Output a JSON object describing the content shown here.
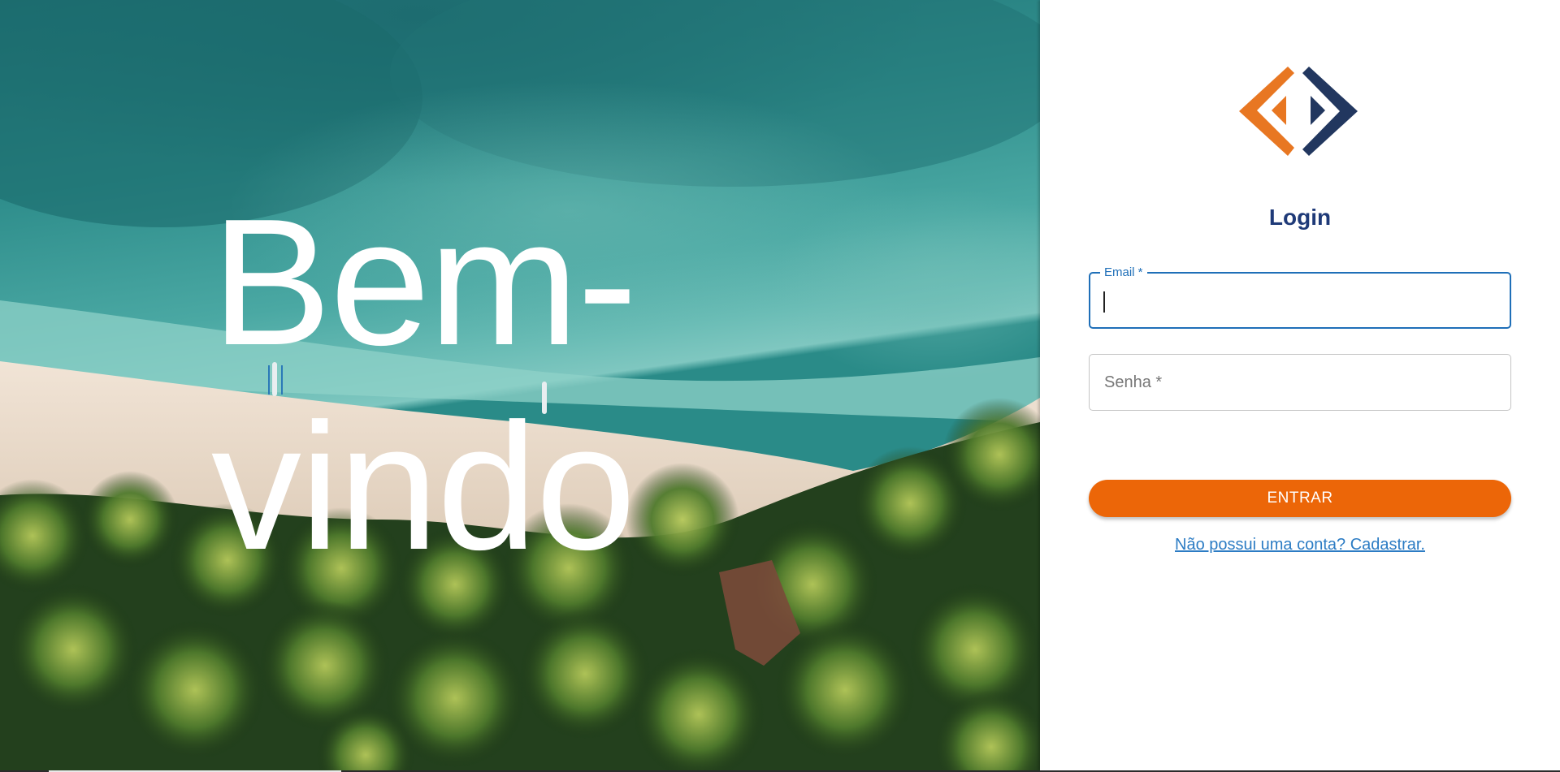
{
  "hero": {
    "line1": "Bem-",
    "line2": "vindo"
  },
  "login": {
    "title": "Login",
    "email": {
      "label": "Email *",
      "value": ""
    },
    "password": {
      "placeholder": "Senha *",
      "value": ""
    },
    "submit_label": "ENTRAR",
    "register_link": "Não possui uma conta? Cadastrar."
  },
  "logo": {
    "name": "brand-logo",
    "colors": {
      "orange": "#e87722",
      "navy": "#22375f"
    }
  },
  "colors": {
    "accent": "#ec6608",
    "title": "#1f3a78",
    "focus": "#1f6fb8",
    "link": "#2c7cc4"
  }
}
